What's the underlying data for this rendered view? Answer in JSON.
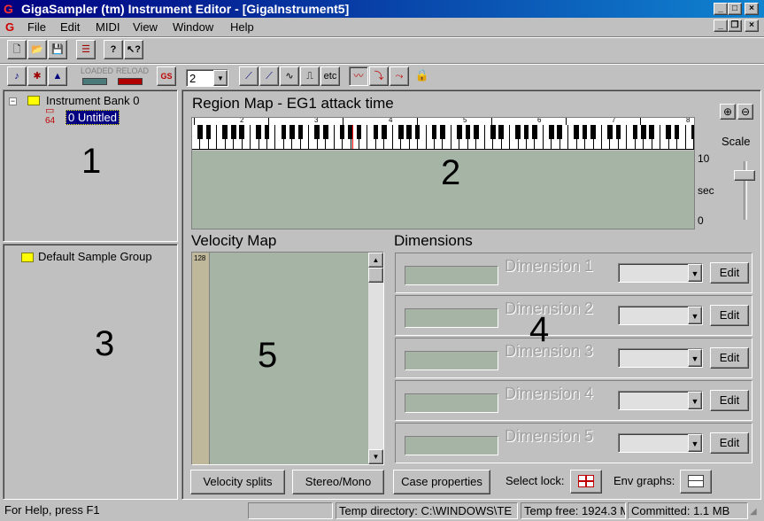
{
  "window": {
    "app_icon": "G",
    "title": "GigaSampler (tm) Instrument Editor - [GigaInstrument5]"
  },
  "menu": [
    "File",
    "Edit",
    "MIDI",
    "View",
    "Window",
    "Help"
  ],
  "toolbar2": {
    "loaded_label": "LOADED",
    "reload_label": "RELOAD",
    "gs_label": "GS",
    "combo_value": "2",
    "etc_label": "etc"
  },
  "tree": {
    "bank": "Instrument Bank 0",
    "instrument_index": "64",
    "instrument": "0 Untitled",
    "sample_group": "Default Sample Group"
  },
  "region_map": {
    "title": "Region Map - EG1 attack time",
    "octaves": [
      "2",
      "3",
      "4",
      "5",
      "6",
      "7",
      "8"
    ],
    "scale_label": "Scale",
    "y_top": "10",
    "y_unit": "sec",
    "y_bottom": "0"
  },
  "velocity_map": {
    "title": "Velocity Map",
    "top_value": "128"
  },
  "dimensions": {
    "title": "Dimensions",
    "items": [
      "Dimension 1",
      "Dimension 2",
      "Dimension 3",
      "Dimension 4",
      "Dimension 5"
    ],
    "edit_label": "Edit"
  },
  "buttons": {
    "velocity_splits": "Velocity splits",
    "stereo_mono": "Stereo/Mono",
    "case_properties": "Case properties",
    "select_lock": "Select lock:",
    "env_graphs": "Env graphs:"
  },
  "annotations": [
    "1",
    "2",
    "3",
    "4",
    "5"
  ],
  "status": {
    "help": "For Help, press F1",
    "temp_dir": "Temp directory: C:\\WINDOWS\\TE",
    "temp_free": "Temp free: 1924.3 M",
    "committed": "Committed: 1.1 MB"
  },
  "colors": {
    "title_start": "#000080",
    "title_end": "#1084d0",
    "map_fill": "#a5b4a5",
    "selection": "#000080"
  }
}
